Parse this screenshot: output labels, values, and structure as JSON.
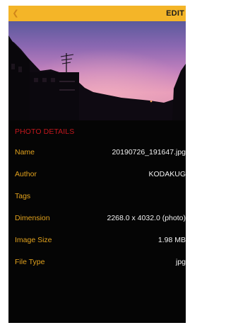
{
  "toolbar": {
    "back_icon": "chevron-left-icon",
    "edit_label": "EDIT"
  },
  "details": {
    "section_title": "PHOTO DETAILS",
    "rows": [
      {
        "label": "Name",
        "value": "20190726_191647.jpg"
      },
      {
        "label": "Author",
        "value": "KODAKUG"
      },
      {
        "label": "Tags",
        "value": ""
      },
      {
        "label": "Dimension",
        "value": "2268.0 x 4032.0 (photo)"
      },
      {
        "label": "Image Size",
        "value": "1.98 MB"
      },
      {
        "label": "File Type",
        "value": "jpg"
      }
    ]
  },
  "colors": {
    "toolbar_bg": "#f4b528",
    "section_title": "#c2171d",
    "label": "#e2a21d",
    "value": "#f2f2f2",
    "background": "#000000"
  }
}
